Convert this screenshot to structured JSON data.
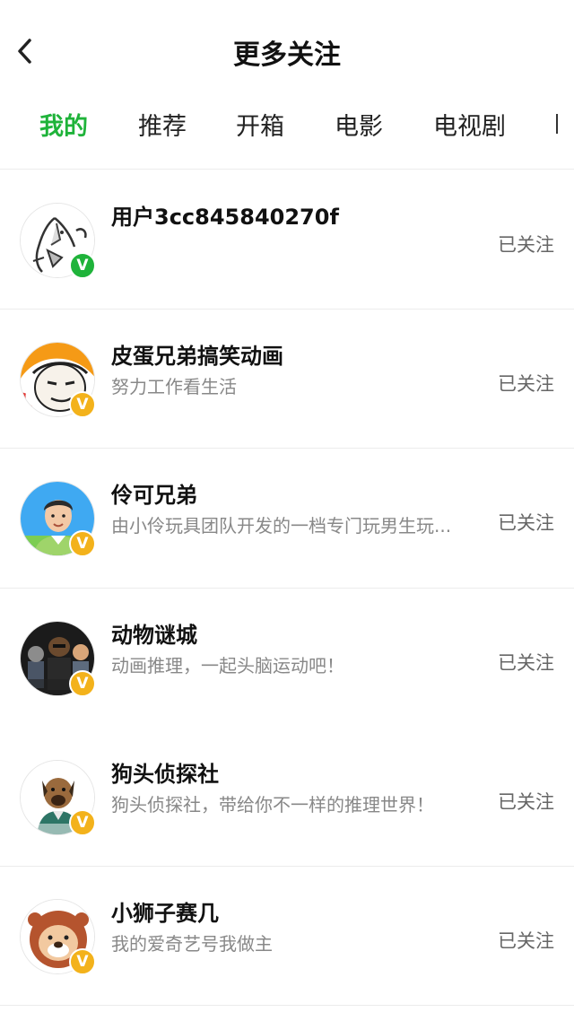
{
  "header": {
    "title": "更多关注",
    "back_icon": "chevron-left-icon"
  },
  "tabs": [
    {
      "label": "我的",
      "active": true
    },
    {
      "label": "推荐",
      "active": false
    },
    {
      "label": "开箱",
      "active": false
    },
    {
      "label": "电影",
      "active": false
    },
    {
      "label": "电视剧",
      "active": false
    }
  ],
  "colors": {
    "accent": "#1fb33a",
    "verified_green": "#1fb33a",
    "verified_gold": "#f3b21b",
    "secondary_text": "#888888"
  },
  "follows": [
    {
      "name": "用户3cc845840270f",
      "description": "",
      "status": "已关注",
      "badge": "V",
      "badge_color": "green",
      "avatar_icon": "doodle-avatar"
    },
    {
      "name": "皮蛋兄弟搞笑动画",
      "description": "努力工作看生活",
      "status": "已关注",
      "badge": "V",
      "badge_color": "gold",
      "avatar_icon": "helmet-face-avatar"
    },
    {
      "name": "伶可兄弟",
      "description": "由小伶玩具团队开发的一档专门玩男生玩...",
      "status": "已关注",
      "badge": "V",
      "badge_color": "gold",
      "avatar_icon": "person-avatar"
    },
    {
      "name": "动物谜城",
      "description": "动画推理，一起头脑运动吧！",
      "status": "已关注",
      "badge": "V",
      "badge_color": "gold",
      "avatar_icon": "animal-group-avatar"
    },
    {
      "name": "狗头侦探社",
      "description": "狗头侦探社，带给你不一样的推理世界！",
      "status": "已关注",
      "badge": "V",
      "badge_color": "gold",
      "avatar_icon": "dog-detective-avatar"
    },
    {
      "name": "小狮子赛几",
      "description": "我的爱奇艺号我做主",
      "status": "已关注",
      "badge": "V",
      "badge_color": "gold",
      "avatar_icon": "lion-avatar"
    }
  ]
}
